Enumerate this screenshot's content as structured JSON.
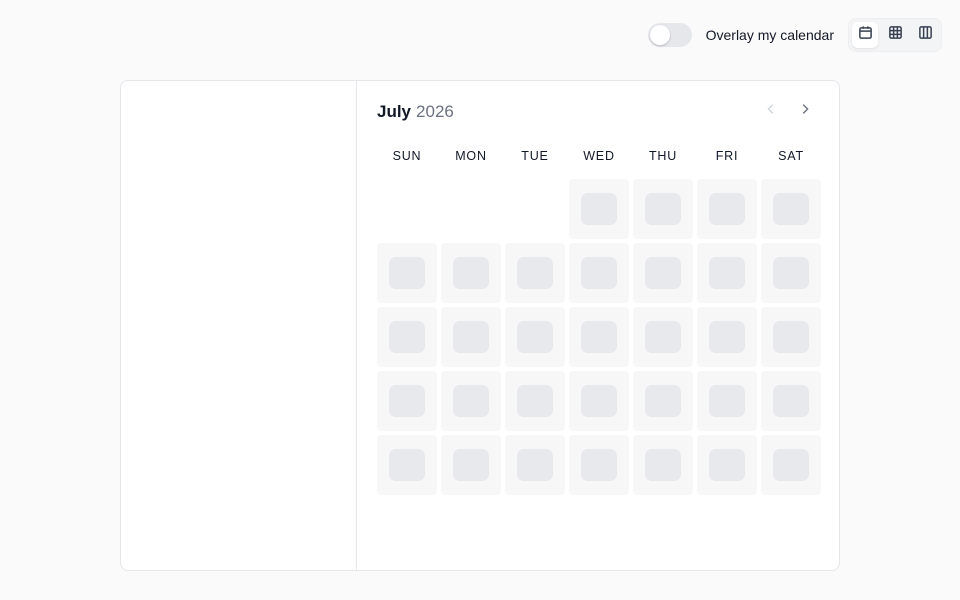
{
  "header": {
    "overlay_label": "Overlay my calendar",
    "overlay_enabled": false,
    "views": [
      {
        "name": "month",
        "icon": "calendar-icon",
        "active": true
      },
      {
        "name": "week",
        "icon": "grid-icon",
        "active": false
      },
      {
        "name": "column",
        "icon": "columns-icon",
        "active": false
      }
    ]
  },
  "calendar": {
    "month": "July",
    "year": "2026",
    "weekdays": [
      "SUN",
      "MON",
      "TUE",
      "WED",
      "THU",
      "FRI",
      "SAT"
    ],
    "leading_empty_days": 3,
    "loading_day_count": 32,
    "state": "loading"
  },
  "colors": {
    "background": "#fafafa",
    "skeleton": "#e8e9ec",
    "cell": "#f7f7f8"
  }
}
